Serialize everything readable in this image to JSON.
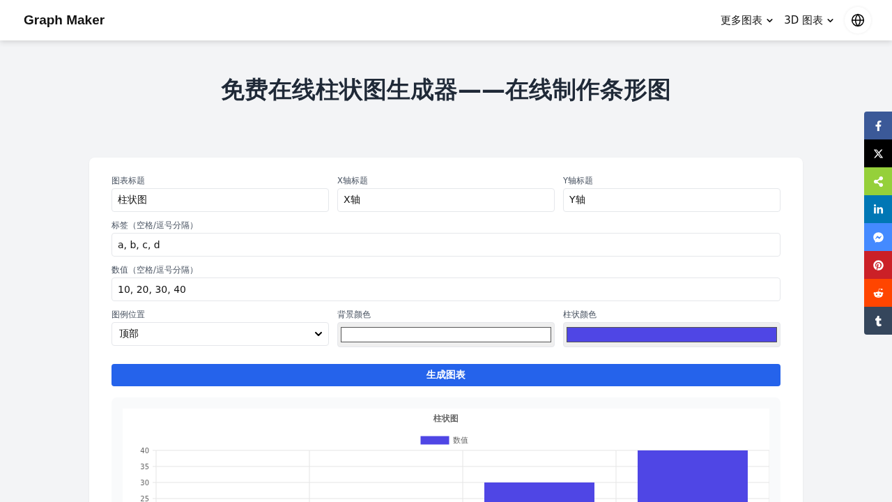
{
  "header": {
    "brand": "Graph Maker",
    "nav": [
      {
        "label": "更多图表",
        "kind": "dropdown"
      },
      {
        "label": "3D 图表",
        "kind": "dropdown"
      },
      {
        "kind": "language"
      }
    ]
  },
  "page_title": "免费在线柱状图生成器——在线制作条形图",
  "form": {
    "rows": [
      [
        {
          "kind": "text",
          "label": "图表标题",
          "value": "柱状图"
        },
        {
          "kind": "text",
          "label": "X轴标题",
          "value": "X轴"
        },
        {
          "kind": "text",
          "label": "Y轴标题",
          "value": "Y轴"
        }
      ],
      [
        {
          "kind": "text",
          "label": "标签（空格/逗号分隔）",
          "value": "a, b, c, d"
        }
      ],
      [
        {
          "kind": "text",
          "label": "数值（空格/逗号分隔）",
          "value": "10, 20, 30, 40"
        }
      ],
      [
        {
          "kind": "select",
          "label": "图例位置",
          "value": "顶部"
        },
        {
          "kind": "color",
          "label": "背景颜色",
          "color": "#ffffff"
        },
        {
          "kind": "color",
          "label": "柱状颜色",
          "color": "#4f46e5"
        }
      ]
    ],
    "submit": "生成图表"
  },
  "chart": {
    "chart_data": {
      "type": "bar",
      "title": "柱状图",
      "series": [
        {
          "name": "数值",
          "color": "#4f46e5",
          "values": [
            null,
            null,
            30,
            40
          ]
        }
      ],
      "ylim": [
        0,
        40
      ],
      "yticks": [
        25,
        30,
        35,
        40
      ],
      "grid": true
    }
  },
  "share": [
    {
      "kind": "facebook",
      "color": "#3b5998"
    },
    {
      "kind": "x",
      "color": "#000000"
    },
    {
      "kind": "share",
      "color": "#95d03a"
    },
    {
      "kind": "linkedin",
      "color": "#0077b5"
    },
    {
      "kind": "messenger",
      "color": "#448aff"
    },
    {
      "kind": "pinterest",
      "color": "#cb2027"
    },
    {
      "kind": "reddit",
      "color": "#ff4500"
    },
    {
      "kind": "tumblr",
      "color": "#35465c"
    }
  ]
}
